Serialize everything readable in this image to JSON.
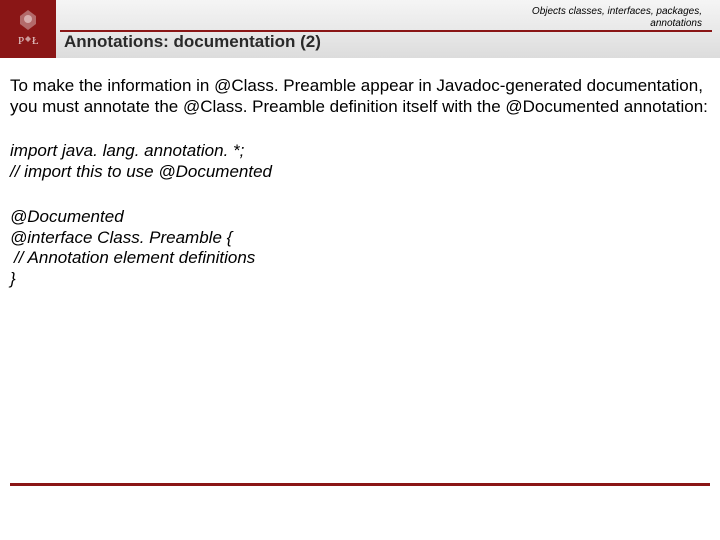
{
  "header": {
    "category_line1": "Objects classes, interfaces, packages,",
    "category_line2": "annotations",
    "title": "Annotations: documentation (2)"
  },
  "body": {
    "paragraph": "To make the information in @Class. Preamble appear in Javadoc-generated documentation, you must annotate the @Class. Preamble definition itself with the @Documented annotation:",
    "code1": {
      "line1": "import java. lang. annotation. *;",
      "line2": "// import this to use @Documented"
    },
    "code2": {
      "line1": "@Documented",
      "line2": "@interface Class. Preamble {",
      "line3": " // Annotation element definitions",
      "line4": "}"
    }
  }
}
